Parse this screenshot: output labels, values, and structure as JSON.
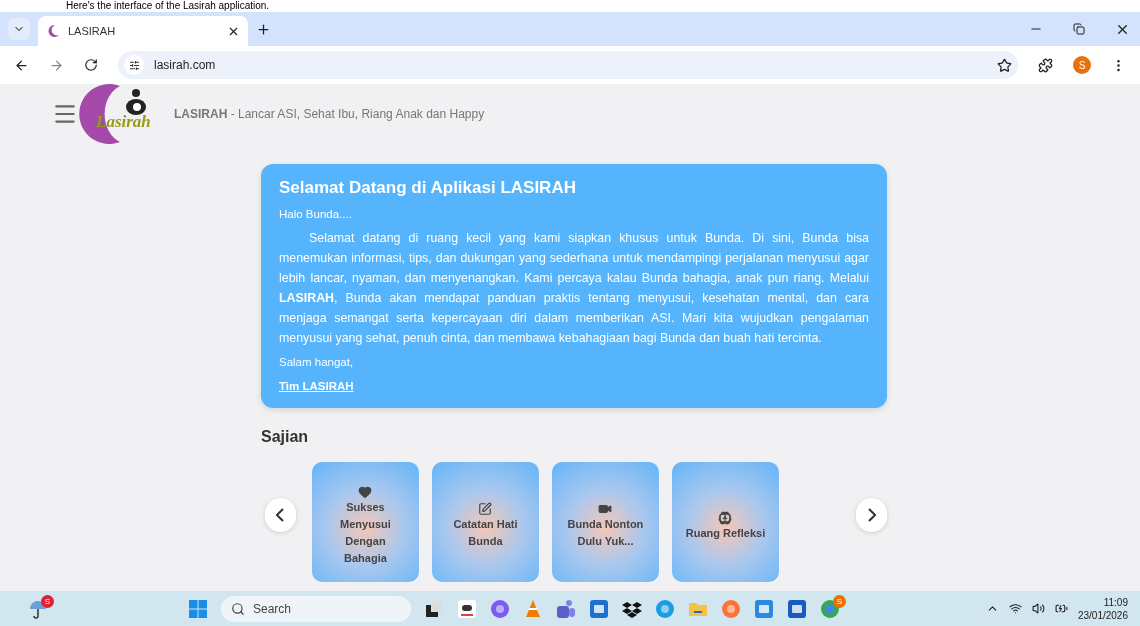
{
  "caption": "Here's the interface of the Lasirah application.",
  "browser": {
    "tabs": [
      {
        "title": "LASIRAH",
        "selected": true
      }
    ],
    "url": "lasirah.com",
    "profile": "S"
  },
  "header": {
    "logo_text": "Lasirah",
    "brand": "LASIRAH",
    "tagline": " - Lancar ASI, Sehat Ibu, Riang Anak dan Happy"
  },
  "welcome": {
    "title": "Selamat Datang di Aplikasi LASIRAH",
    "greeting": "Halo Bunda....",
    "body": "Selamat datang di ruang kecil yang kami siapkan khusus untuk Bunda. Di sini, Bunda bisa menemukan informasi, tips, dan dukungan yang sederhana untuk mendampingi perjalanan menyusui agar lebih lancar, nyaman, dan menyenangkan. Kami percaya kalau Bunda bahagia, anak pun riang. Melalui **LASIRAH**, Bunda akan mendapat panduan praktis tentang menyusui, kesehatan mental, dan cara menjaga semangat serta kepercayaan diri dalam memberikan ASI. Mari kita wujudkan pengalaman menyusui yang sehat, penuh cinta, dan membawa kebahagiaan bagi Bunda dan buah hati tercinta.",
    "closing": "Salam hangat,",
    "signature": "Tim LASIRAH"
  },
  "sajian": {
    "title": "Sajian",
    "cards": [
      {
        "kind": "heart",
        "label": "Sukses Menyusui Dengan Bahagia"
      },
      {
        "kind": "note",
        "label": "Catatan Hati Bunda"
      },
      {
        "kind": "video",
        "label": "Bunda Nonton Dulu Yuk..."
      },
      {
        "kind": "brain",
        "label": "Ruang Refleksi"
      }
    ]
  },
  "taskbar": {
    "weather_badge": "S",
    "search": "Search",
    "apps": [
      {
        "kind": "files"
      },
      {
        "kind": "store-a"
      },
      {
        "kind": "copilot"
      },
      {
        "kind": "vlc"
      },
      {
        "kind": "teams"
      },
      {
        "kind": "store"
      },
      {
        "kind": "dropbox"
      },
      {
        "kind": "edge"
      },
      {
        "kind": "folder"
      },
      {
        "kind": "firefox"
      },
      {
        "kind": "calendar"
      },
      {
        "kind": "word"
      },
      {
        "kind": "chrome",
        "badge": "S"
      }
    ],
    "time": "11:09",
    "date": "23/01/2026"
  }
}
